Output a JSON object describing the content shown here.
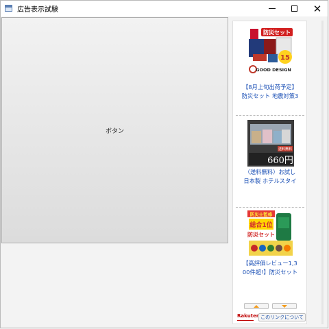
{
  "window": {
    "title": "広告表示試験"
  },
  "main": {
    "button_label": "ボタン"
  },
  "ads": [
    {
      "line1": "【8月上旬出荷予定】",
      "line2": "防災セット 地震対策3",
      "badge_text": "防災セット",
      "mark_text": "GOOD DESIGN",
      "number": "15"
    },
    {
      "line1": "（送料無料）お試し",
      "line2": "日本製 ホテルスタイ",
      "price": "660円",
      "corner": "送料無料"
    },
    {
      "line1": "【高評価レビュー1,3",
      "line2": "00件超!】防災セット",
      "banner": "防災士監修",
      "rank": "総合1位",
      "product": "防災セット"
    }
  ],
  "footer": {
    "brand": "Rakuten",
    "about_label": "このリンクについて"
  },
  "colors": {
    "link": "#1a4fb5",
    "accent_orange": "#f39c1c",
    "brand_red": "#bf0000"
  }
}
